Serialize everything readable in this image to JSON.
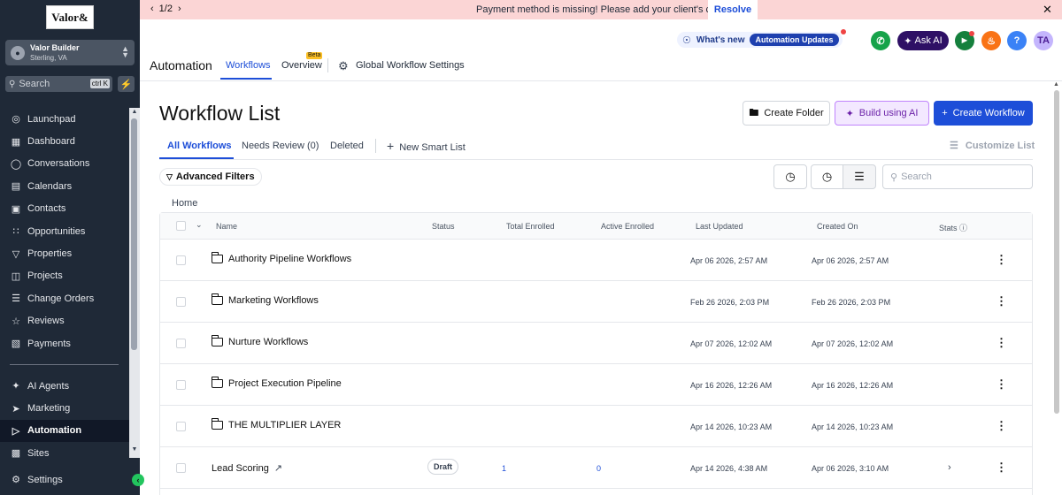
{
  "sidebar": {
    "logo": "Valor&",
    "account": {
      "name": "Valor Builder",
      "location": "Sterling, VA"
    },
    "search": {
      "placeholder": "Search",
      "shortcut": "ctrl K"
    },
    "items": [
      {
        "label": "Launchpad",
        "icon": "rocket-icon"
      },
      {
        "label": "Dashboard",
        "icon": "grid-icon"
      },
      {
        "label": "Conversations",
        "icon": "chat-icon"
      },
      {
        "label": "Calendars",
        "icon": "calendar-icon"
      },
      {
        "label": "Contacts",
        "icon": "contacts-icon"
      },
      {
        "label": "Opportunities",
        "icon": "network-icon"
      },
      {
        "label": "Properties",
        "icon": "filter-icon"
      },
      {
        "label": "Projects",
        "icon": "projects-icon"
      },
      {
        "label": "Change Orders",
        "icon": "list-icon"
      },
      {
        "label": "Reviews",
        "icon": "star-icon"
      },
      {
        "label": "Payments",
        "icon": "receipt-icon"
      }
    ],
    "items2": [
      {
        "label": "AI Agents",
        "icon": "sparkle-icon"
      },
      {
        "label": "Marketing",
        "icon": "send-icon"
      },
      {
        "label": "Automation",
        "icon": "automation-icon"
      },
      {
        "label": "Sites",
        "icon": "sites-icon"
      }
    ],
    "settings": "Settings"
  },
  "banner": {
    "pager": "1/2",
    "message": "Payment method is missing! Please add your client's card.",
    "resolve": "Resolve"
  },
  "header": {
    "whats_new": "What's new",
    "updates": "Automation Updates",
    "ask_ai": "Ask AI",
    "avatar": "TA",
    "help": "?"
  },
  "nav": {
    "title": "Automation",
    "tabs": [
      "Workflows",
      "Overview",
      "Global Workflow Settings"
    ],
    "beta": "Beta"
  },
  "page": {
    "title": "Workflow List",
    "create_folder": "Create Folder",
    "build_ai": "Build using AI",
    "create_workflow": "Create Workflow",
    "subtabs": [
      "All Workflows",
      "Needs Review (0)",
      "Deleted",
      "New Smart List"
    ],
    "customize": "Customize List",
    "advanced_filters": "Advanced Filters",
    "search_placeholder": "Search",
    "breadcrumb": "Home"
  },
  "table": {
    "headers": [
      "Name",
      "Status",
      "Total Enrolled",
      "Active Enrolled",
      "Last Updated",
      "Created On",
      "Stats"
    ],
    "rows": [
      {
        "name": "Authority Pipeline Workflows",
        "last_updated": "Apr 06 2026, 2:57 AM",
        "created_on": "Apr 06 2026, 2:57 AM"
      },
      {
        "name": "Marketing Workflows",
        "last_updated": "Feb 26 2026, 2:03 PM",
        "created_on": "Feb 26 2026, 2:03 PM"
      },
      {
        "name": "Nurture Workflows",
        "last_updated": "Apr 07 2026, 12:02 AM",
        "created_on": "Apr 07 2026, 12:02 AM"
      },
      {
        "name": "Project Execution Pipeline",
        "last_updated": "Apr 16 2026, 12:26 AM",
        "created_on": "Apr 16 2026, 12:26 AM"
      },
      {
        "name": "THE MULTIPLIER LAYER",
        "last_updated": "Apr 14 2026, 10:23 AM",
        "created_on": "Apr 14 2026, 10:23 AM"
      }
    ],
    "workflow_row": {
      "name": "Lead Scoring",
      "status": "Draft",
      "total_enrolled": "1",
      "active_enrolled": "0",
      "last_updated": "Apr 14 2026, 4:38 AM",
      "created_on": "Apr 06 2026, 3:10 AM"
    }
  }
}
